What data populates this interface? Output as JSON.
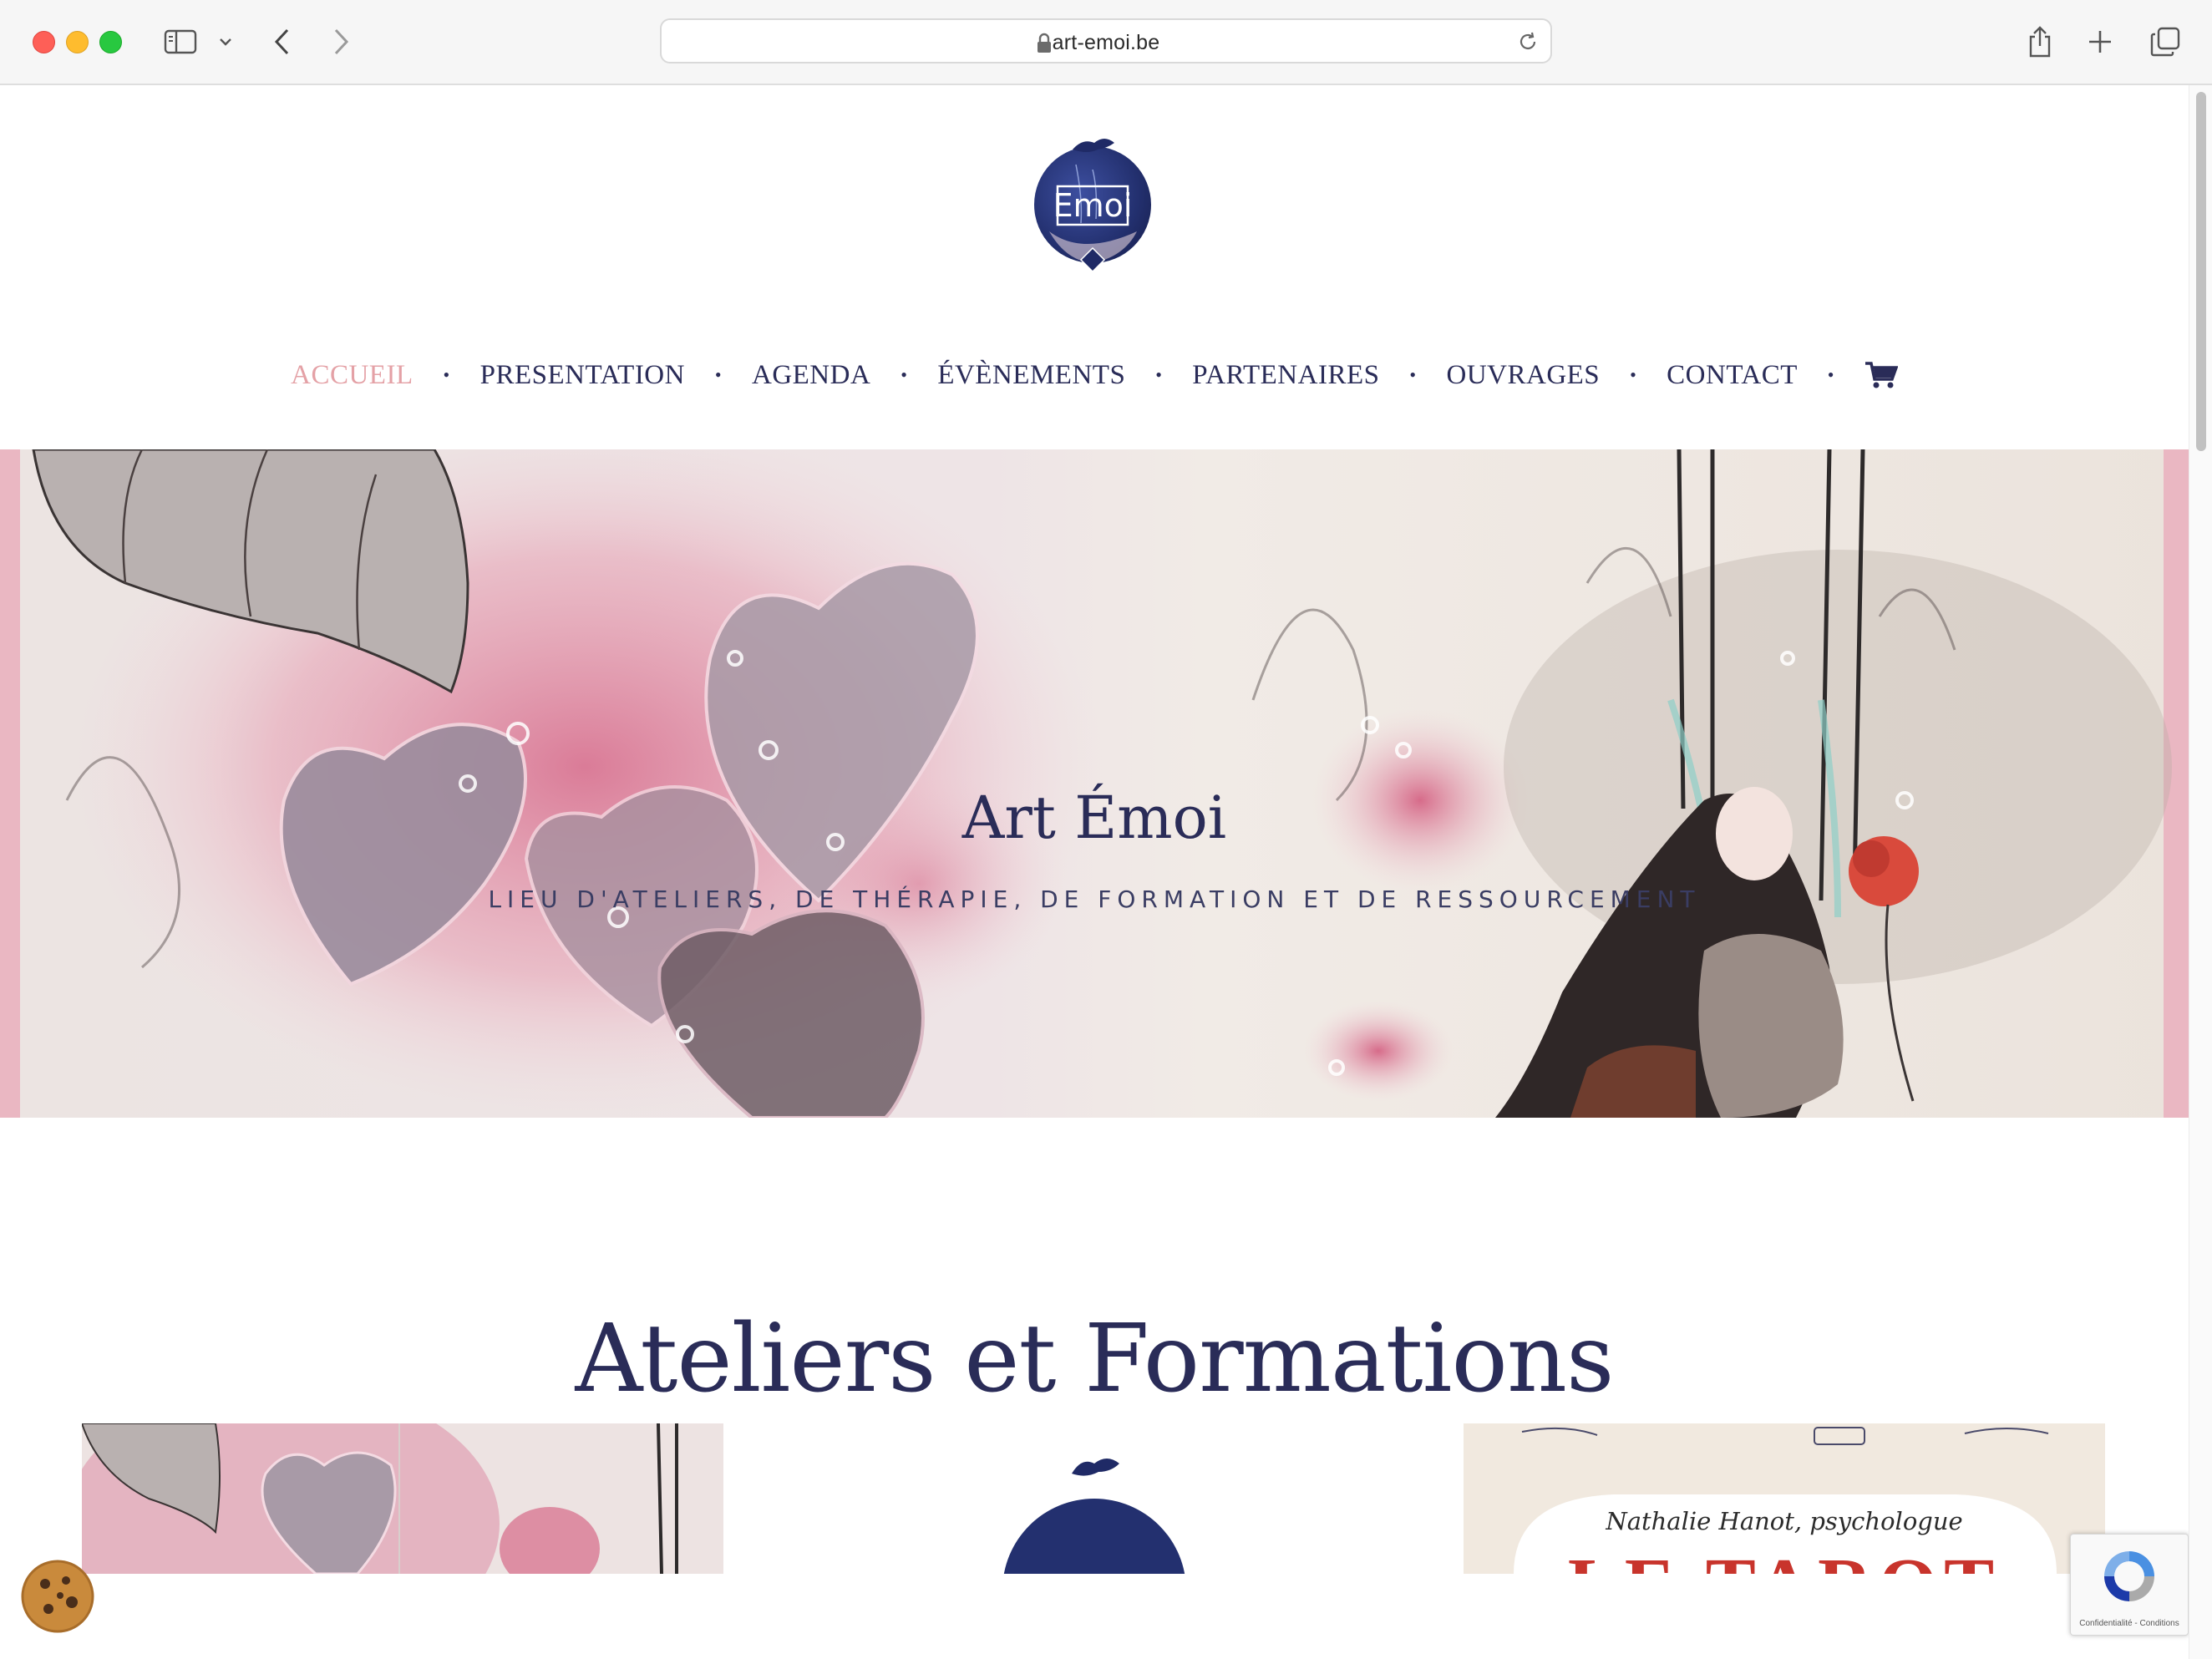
{
  "browser": {
    "url": "art-emoi.be"
  },
  "site": {
    "logo_text": "Emoi",
    "nav": [
      {
        "label": "ACCUEIL",
        "active": true
      },
      {
        "label": "PRESENTATION",
        "active": false
      },
      {
        "label": "AGENDA",
        "active": false
      },
      {
        "label": "ÉVÈNEMENTS",
        "active": false
      },
      {
        "label": "PARTENAIRES",
        "active": false
      },
      {
        "label": "OUVRAGES",
        "active": false
      },
      {
        "label": "CONTACT",
        "active": false
      }
    ],
    "nav_separator": "•",
    "cart_icon": "cart-icon"
  },
  "hero": {
    "title": "Art Émoi",
    "subtitle": "LIEU D'ATELIERS, DE THÉRAPIE, DE FORMATION ET DE RESSOURCEMENT"
  },
  "section": {
    "title": "Ateliers et Formations"
  },
  "cards": {
    "book_author": "Nathalie Hanot, psychologue",
    "book_title": "LE TAROT"
  },
  "recaptcha": {
    "label": "Confidentialité - Conditions"
  },
  "colors": {
    "navy": "#2a2c58",
    "active_nav": "#e4a1a6",
    "book_red": "#c8342c"
  }
}
